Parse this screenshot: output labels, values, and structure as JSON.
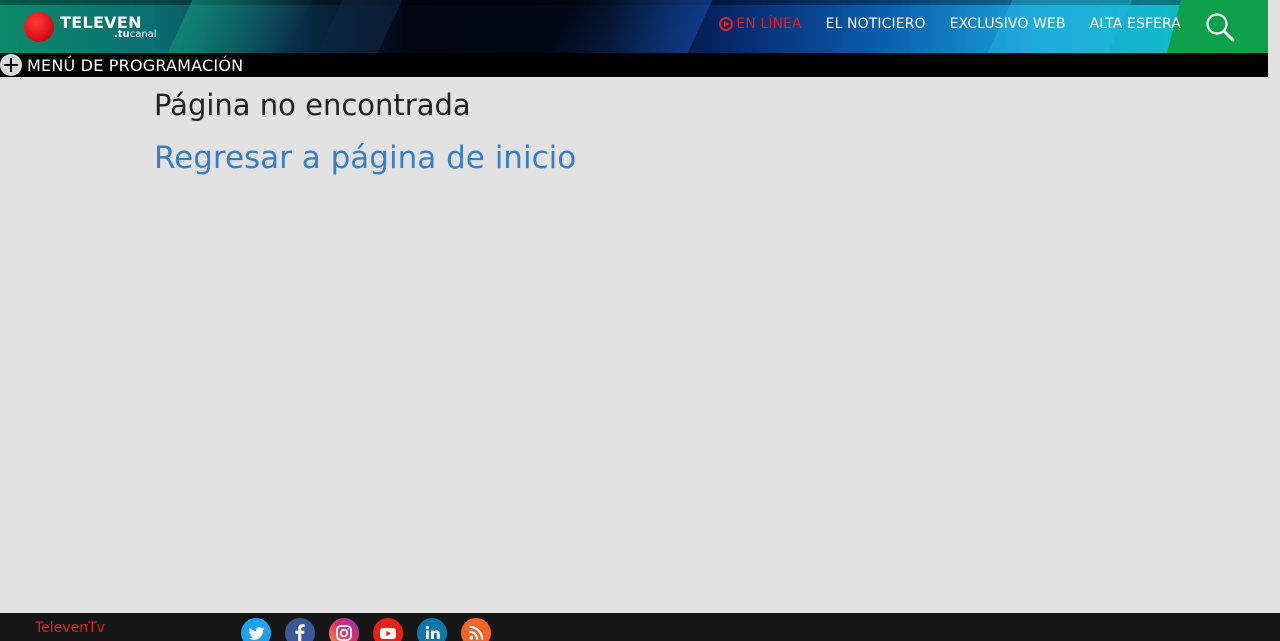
{
  "header": {
    "logo_name": "TELEVEN",
    "logo_sub_prefix": ".tu",
    "logo_sub_suffix": "canal",
    "nav": [
      {
        "label": "EN LÍNEA",
        "icon": "play-circle-icon",
        "color": "#e11f26"
      },
      {
        "label": "EL NOTICIERO"
      },
      {
        "label": "EXCLUSIVO WEB"
      },
      {
        "label": "ALTA ESFERA"
      }
    ],
    "search_icon": "search-icon"
  },
  "program_menu": {
    "label": "MENÚ DE PROGRAMACIÓN",
    "icon": "plus-circle-icon"
  },
  "main": {
    "title": "Página no encontrada",
    "home_link": "Regresar a página de inicio",
    "link_color": "#3a7fc1"
  },
  "footer": {
    "brand": "TelevenTv",
    "brand_color": "#e11f26",
    "social": [
      {
        "name": "twitter-icon",
        "color": "#1da1f2"
      },
      {
        "name": "facebook-icon",
        "color": "#3b5998"
      },
      {
        "name": "instagram-icon",
        "color": "#c13584"
      },
      {
        "name": "youtube-icon",
        "color": "#e62117"
      },
      {
        "name": "linkedin-icon",
        "color": "#0e76a8"
      },
      {
        "name": "rss-icon",
        "color": "#f26522"
      }
    ]
  }
}
